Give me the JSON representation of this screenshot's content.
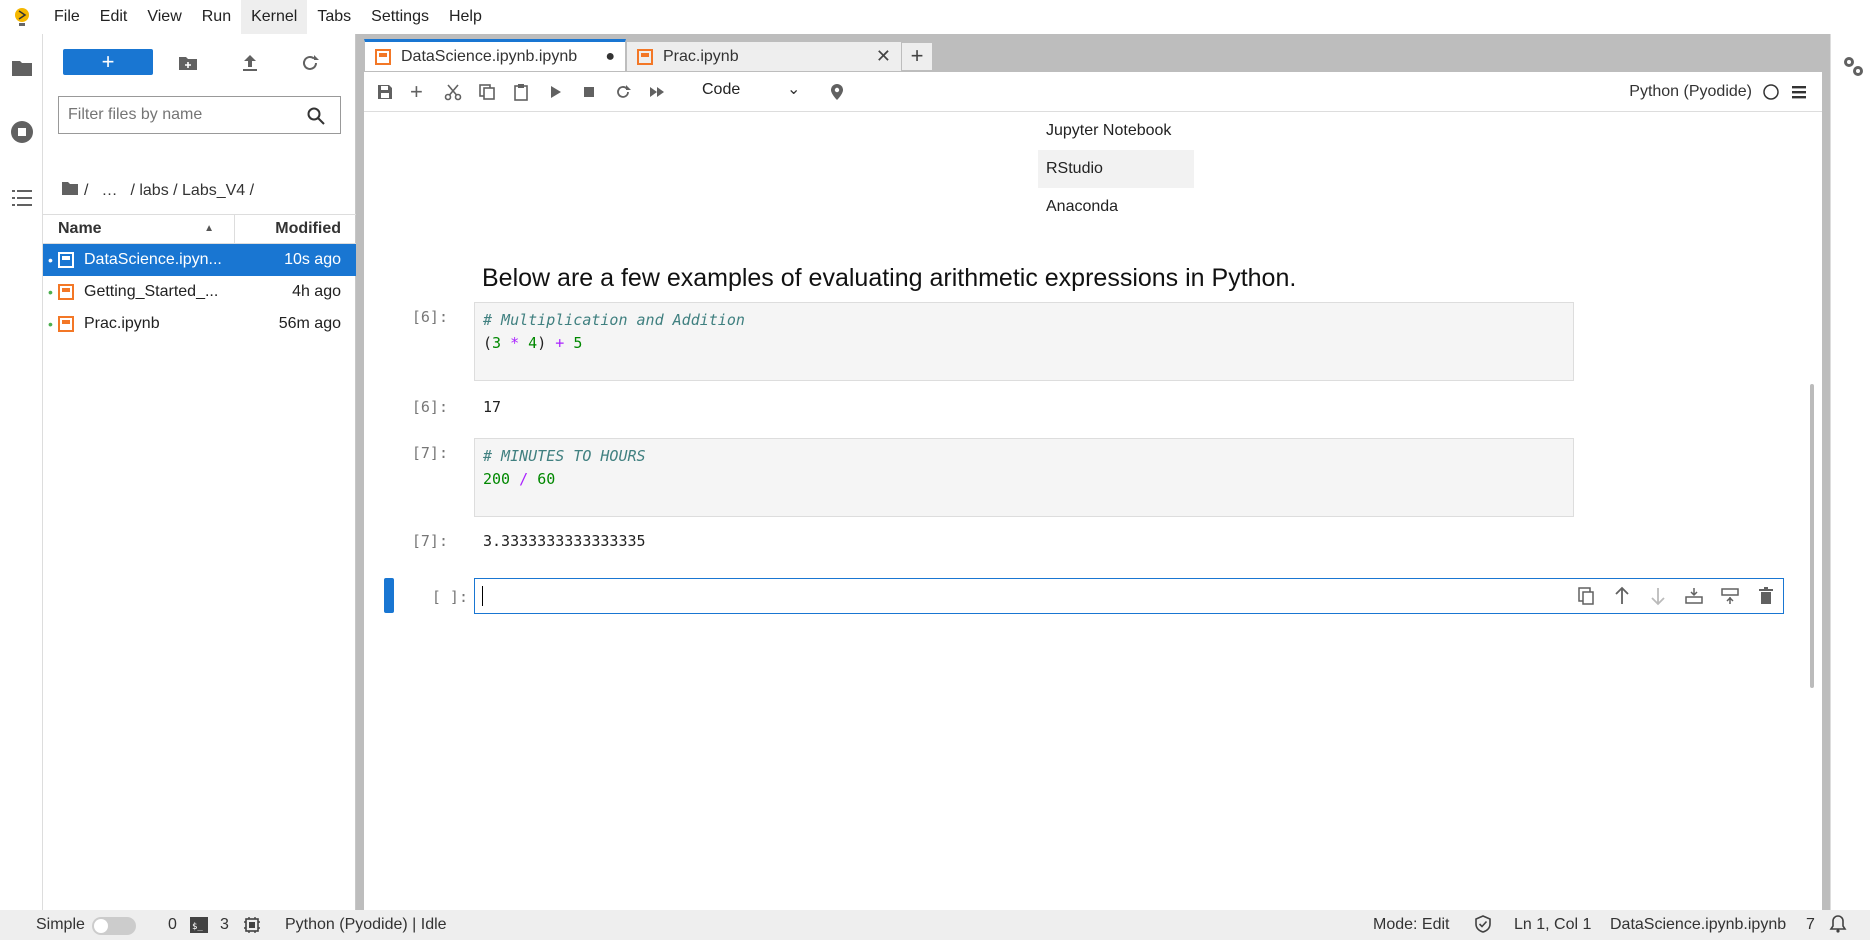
{
  "menubar": {
    "items": [
      "File",
      "Edit",
      "View",
      "Run",
      "Kernel",
      "Tabs",
      "Settings",
      "Help"
    ],
    "active_item": "Kernel"
  },
  "filebrowser": {
    "new_button_label": "+",
    "filter_placeholder": "Filter files by name",
    "breadcrumb": [
      "/",
      "…",
      "/ labs / Labs_V4 /"
    ],
    "columns": {
      "name": "Name",
      "modified": "Modified"
    },
    "files": [
      {
        "name": "DataScience.ipyn...",
        "modified": "10s ago",
        "selected": true
      },
      {
        "name": "Getting_Started_...",
        "modified": "4h ago",
        "selected": false
      },
      {
        "name": "Prac.ipynb",
        "modified": "56m ago",
        "selected": false
      }
    ]
  },
  "tabs": [
    {
      "label": "DataScience.ipynb.ipynb",
      "current": true,
      "dirty": true
    },
    {
      "label": "Prac.ipynb",
      "current": false
    }
  ],
  "toolbar": {
    "cell_type": "Code",
    "kernel": "Python (Pyodide)"
  },
  "notebook": {
    "md_list": [
      "Jupyter Notebook",
      "RStudio",
      "Anaconda"
    ],
    "heading": "Below are a few examples of evaluating arithmetic expressions in Python.",
    "cells": [
      {
        "prompt": "[6]:",
        "comment": "# Multiplication and Addition",
        "out_prompt": "[6]:",
        "output": "17"
      },
      {
        "prompt": "[7]:",
        "comment": "# MINUTES TO HOURS",
        "out_prompt": "[7]:",
        "output": "3.3333333333333335"
      }
    ],
    "active_prompt": "[ ]:"
  },
  "statusbar": {
    "mode_label": "Simple",
    "count1": "0",
    "count2": "3",
    "kernel_status": "Python (Pyodide) | Idle",
    "edit_mode": "Mode: Edit",
    "cursor": "Ln 1, Col 1",
    "filename": "DataScience.ipynb.ipynb",
    "notif_count": "7"
  },
  "colors": {
    "accent": "#1976d2",
    "notebook_icon": "#f37726"
  }
}
